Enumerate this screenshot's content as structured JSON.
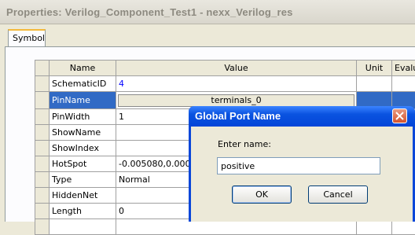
{
  "window": {
    "title": "Properties: Verilog_Component_Test1 - nexx_Verilog_res"
  },
  "tabs": [
    {
      "label": "Symbol"
    }
  ],
  "grid": {
    "headers": {
      "name": "Name",
      "value": "Value",
      "unit": "Unit",
      "eval": "Evalu"
    },
    "rows": [
      {
        "name": "SchematicID",
        "value": "4",
        "value_color": "blue"
      },
      {
        "name": "PinName",
        "value": "terminals_0",
        "selected": true
      },
      {
        "name": "PinWidth",
        "value": "1"
      },
      {
        "name": "ShowName",
        "value": ""
      },
      {
        "name": "ShowIndex",
        "value": ""
      },
      {
        "name": "HotSpot",
        "value": "-0.005080,0.000000"
      },
      {
        "name": "Type",
        "value": "Normal"
      },
      {
        "name": "HiddenNet",
        "value": ""
      },
      {
        "name": "Length",
        "value": "0"
      },
      {
        "name": "",
        "value": ""
      }
    ]
  },
  "dialog": {
    "title": "Global Port Name",
    "prompt": "Enter name:",
    "input_value": "positive",
    "ok_label": "OK",
    "cancel_label": "Cancel"
  },
  "colors": {
    "selection": "#316ac5",
    "dialog_caption": "#0a53e0",
    "tab_highlight": "#f4b93b"
  }
}
